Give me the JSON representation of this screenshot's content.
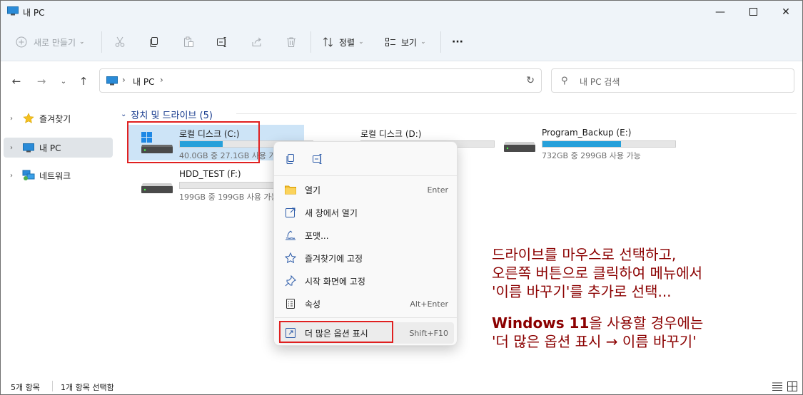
{
  "window": {
    "title": "내 PC"
  },
  "toolbar": {
    "new_label": "새로 만들기",
    "sort_label": "정렬",
    "view_label": "보기",
    "more_label": "···"
  },
  "nav": {
    "breadcrumb": [
      "내 PC"
    ],
    "search_placeholder": "내 PC 검색"
  },
  "sidebar": {
    "items": [
      {
        "label": "즐겨찾기",
        "icon": "star-icon"
      },
      {
        "label": "내 PC",
        "icon": "pc-icon",
        "selected": true
      },
      {
        "label": "네트워크",
        "icon": "network-icon"
      }
    ]
  },
  "content": {
    "group_title": "장치 및 드라이브 (5)",
    "drives": [
      {
        "name": "로컬 디스크 (C:)",
        "size_text": "40.0GB 중 27.1GB 사용 가능",
        "used_fraction": 0.32,
        "selected": true,
        "windows_logo": true
      },
      {
        "name": "로컬 디스크 (D:)",
        "size_text": "",
        "used_fraction": 0.38
      },
      {
        "name": "Program_Backup (E:)",
        "size_text": "732GB 중 299GB 사용 가능",
        "used_fraction": 0.59
      },
      {
        "name": "HDD_TEST (F:)",
        "size_text": "199GB 중 199GB 사용 가능",
        "used_fraction": 0.0
      }
    ]
  },
  "context_menu": {
    "items": [
      {
        "label": "열기",
        "shortcut": "Enter",
        "icon": "folder-icon"
      },
      {
        "label": "새 창에서 열기",
        "shortcut": "",
        "icon": "open-new-window-icon"
      },
      {
        "label": "포맷...",
        "shortcut": "",
        "icon": "format-icon"
      },
      {
        "label": "즐겨찾기에 고정",
        "shortcut": "",
        "icon": "star-outline-icon"
      },
      {
        "label": "시작 화면에 고정",
        "shortcut": "",
        "icon": "pin-icon"
      },
      {
        "label": "속성",
        "shortcut": "Alt+Enter",
        "icon": "properties-icon"
      }
    ],
    "more_options": {
      "label": "더 많은 옵션 표시",
      "shortcut": "Shift+F10",
      "icon": "more-options-icon"
    }
  },
  "annotation": {
    "line1": "드라이브를 마우스로 선택하고,",
    "line2": "오른쪽 버튼으로 클릭하여 메뉴에서",
    "line3": "'이름 바꾸기'를 추가로 선택...",
    "line4_bold": "Windows 11",
    "line4_rest": "을 사용할 경우에는",
    "line5": "'더 많은 옵션 표시 → 이름 바꾸기'"
  },
  "status": {
    "item_count": "5개 항목",
    "selected_count": "1개 항목 선택함"
  },
  "colors": {
    "accent": "#26a0da",
    "selection": "#cde4f7",
    "annotation": "#8b0000",
    "highlight_box": "#e02020"
  }
}
